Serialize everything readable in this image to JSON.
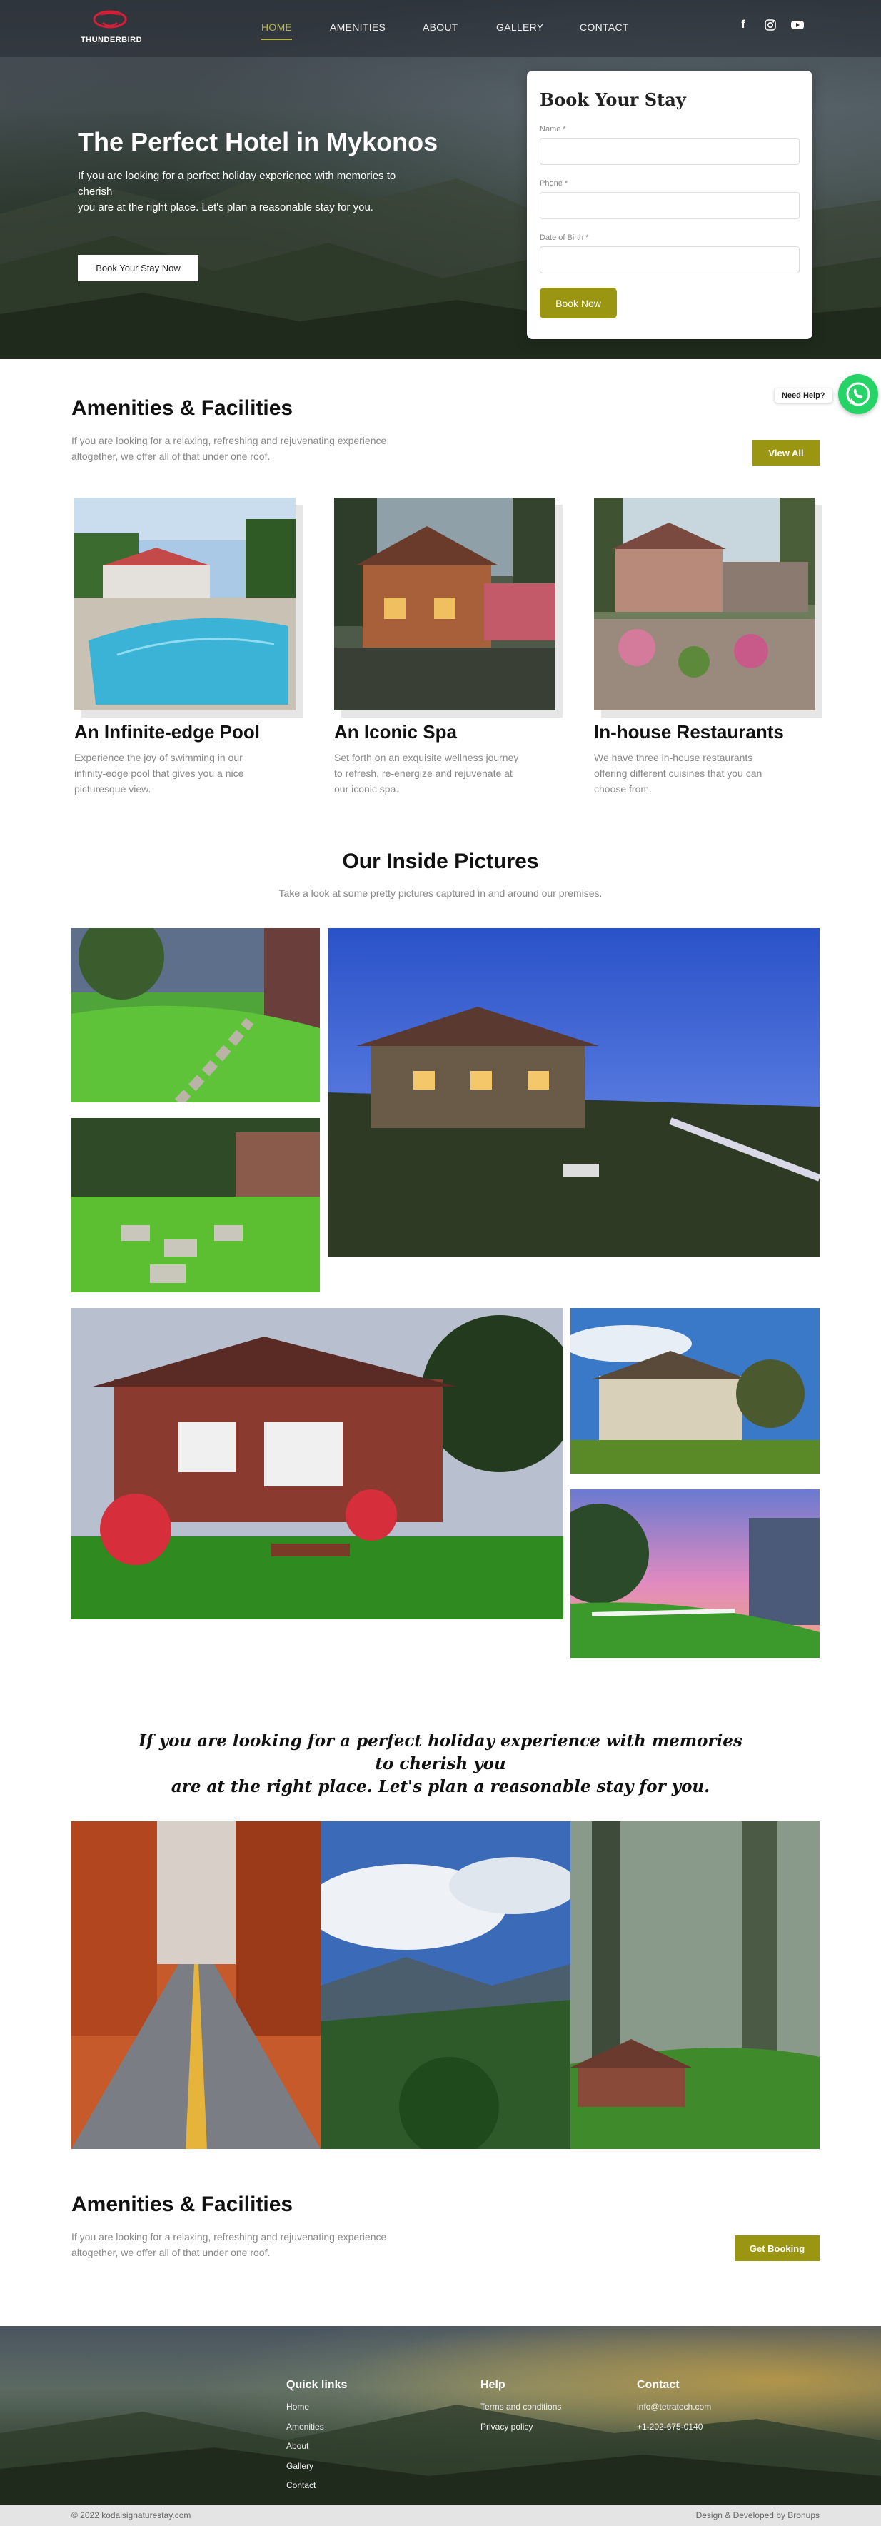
{
  "brand": {
    "name": "THUNDERBIRD"
  },
  "nav": {
    "items": [
      {
        "label": "HOME",
        "active": true
      },
      {
        "label": "AMENITIES"
      },
      {
        "label": "ABOUT"
      },
      {
        "label": "GALLERY"
      },
      {
        "label": "CONTACT"
      }
    ],
    "social": {
      "facebook": "f",
      "instagram": "◎",
      "youtube": "▶"
    }
  },
  "hero": {
    "title": "The Perfect Hotel in Mykonos",
    "subtitle_lines": [
      "If you are looking for a perfect holiday experience with memories to",
      "cherish",
      "you are at the right place. Let's plan a reasonable stay for you."
    ],
    "cta": "Book Your Stay Now"
  },
  "booking": {
    "title": "Book Your Stay",
    "fields": [
      {
        "label": "Name *",
        "value": ""
      },
      {
        "label": "Phone *",
        "value": ""
      },
      {
        "label": "Date of Birth *",
        "value": ""
      }
    ],
    "submit": "Book Now"
  },
  "whatsapp": {
    "label": "Need Help?"
  },
  "amenities": {
    "title": "Amenities & Facilities",
    "desc_lines": [
      "If you are looking for a relaxing, refreshing and rejuvenating experience",
      "altogether, we offer all of that under one roof."
    ],
    "view_all": "View All",
    "items": [
      {
        "title": "An Infinite-edge Pool",
        "desc_lines": [
          "Experience the joy of swimming in our",
          "infinity-edge pool that gives you a nice",
          "picturesque view."
        ]
      },
      {
        "title": "An Iconic Spa",
        "desc_lines": [
          "Set forth on an exquisite wellness journey",
          "to refresh, re-energize and rejuvenate at",
          "our iconic spa."
        ]
      },
      {
        "title": "In-house Restaurants",
        "desc_lines": [
          "We have three in-house restaurants",
          "offering different cuisines that you can",
          "choose from."
        ]
      }
    ]
  },
  "gallery": {
    "title": "Our Inside Pictures",
    "subtitle": "Take a look at some pretty pictures captured in and around our premises."
  },
  "quote": {
    "lines": [
      "If you are looking for a perfect holiday experience with memories to cherish you",
      "are at the right place. Let's plan a reasonable stay for you."
    ]
  },
  "amenities2": {
    "title": "Amenities & Facilities",
    "desc_lines": [
      "If you are looking for a relaxing, refreshing and rejuvenating experience",
      "altogether, we offer all of that under one roof."
    ],
    "cta": "Get Booking"
  },
  "footer": {
    "quick_links": {
      "title": "Quick links",
      "items": [
        "Home",
        "Amenities",
        "About",
        "Gallery",
        "Contact"
      ]
    },
    "help": {
      "title": "Help",
      "items": [
        "Terms and conditions",
        "Privacy policy"
      ]
    },
    "contact": {
      "title": "Contact",
      "items": [
        "info@tetratech.com",
        "+1-202-675-0140"
      ]
    },
    "copyright": "© 2022 kodaisignaturestay.com",
    "credit": "Design & Developed by Bronups"
  },
  "colors": {
    "accent": "#9a9612",
    "nav_active": "#b8b64a",
    "whatsapp": "#25d366"
  }
}
